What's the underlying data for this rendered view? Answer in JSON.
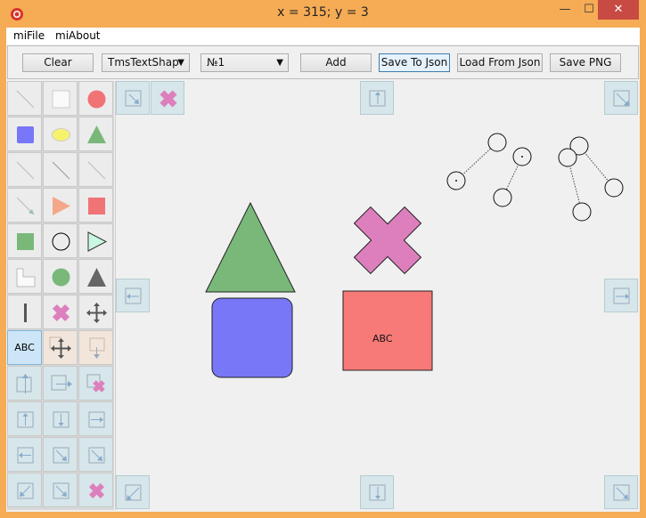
{
  "window": {
    "title": "x = 315; y = 3",
    "minimize": "—",
    "maximize": "☐",
    "close": "✕"
  },
  "menu": {
    "file": "miFile",
    "about": "miAbout"
  },
  "toolbar": {
    "clear": "Clear",
    "shape_combo": "TmsTextShap",
    "number_combo": "№1",
    "add": "Add",
    "save_json": "Save To Json",
    "load_json": "Load From Json",
    "save_png": "Save PNG"
  },
  "palette": {
    "text_cell": "ABC",
    "items": [
      "line",
      "empty-square",
      "red-circle",
      "blue-square",
      "yellow-ellipse",
      "green-triangle",
      "line",
      "line",
      "line",
      "arrow-line",
      "salmon-triangle",
      "red-square",
      "green-square",
      "circle",
      "cyan-triangle",
      "corner-shape",
      "green-circle",
      "gray-triangle",
      "vertical-bar",
      "pink-cross",
      "move-arrows",
      "abc-text",
      "move-arrows-tan",
      "tan-arrow",
      "teal-up",
      "teal-right",
      "pink-cross-small",
      "teal-up",
      "teal-down",
      "teal-right",
      "teal-left",
      "teal-diag",
      "teal-diag",
      "teal-diag-left",
      "teal-diag-right",
      "pink-cross-teal"
    ]
  },
  "canvas": {
    "text_label": "ABC",
    "colors": {
      "triangle": "#7ab87a",
      "rounded_rect": "#7777f7",
      "cross": "#dd7fbd",
      "rect": "#f77a78"
    }
  }
}
